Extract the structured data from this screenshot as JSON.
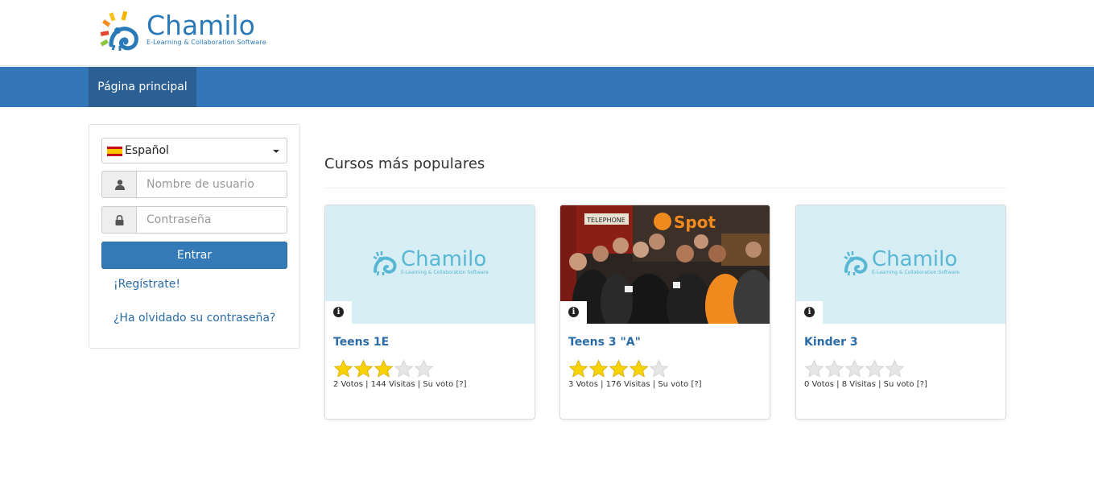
{
  "brand": {
    "name": "Chamilo",
    "tagline": "E-Learning & Collaboration Software"
  },
  "nav": {
    "home_label": "Página principal"
  },
  "login": {
    "language": "Español",
    "username_placeholder": "Nombre de usuario",
    "password_placeholder": "Contraseña",
    "submit_label": "Entrar",
    "register_link": "¡Regístrate!",
    "forgot_link": "¿Ha olvidado su contraseña?"
  },
  "courses": {
    "heading": "Cursos más populares",
    "items": [
      {
        "title": "Teens 1E",
        "rating": 3,
        "meta": "2 Votos | 144 Visitas | Su voto [?]",
        "thumb": "chamilo-logo"
      },
      {
        "title": "Teens 3 \"A\"",
        "rating": 4,
        "meta": "3 Votos | 176 Visitas | Su voto [?]",
        "thumb": "photo",
        "photo_signs": [
          "TELEPHONE",
          "Spot"
        ]
      },
      {
        "title": "Kinder 3",
        "rating": 0,
        "meta": "0 Votos | 8 Visitas | Su voto [?]",
        "thumb": "chamilo-logo"
      }
    ]
  },
  "colors": {
    "navbar": "#3377b8",
    "nav_active": "#2c5f94",
    "primary_button": "#337ab7",
    "link": "#2a6ca8",
    "thumb_bg": "#d7eef4",
    "star_on": "#f7d205",
    "star_off": "#e6e6e6"
  }
}
